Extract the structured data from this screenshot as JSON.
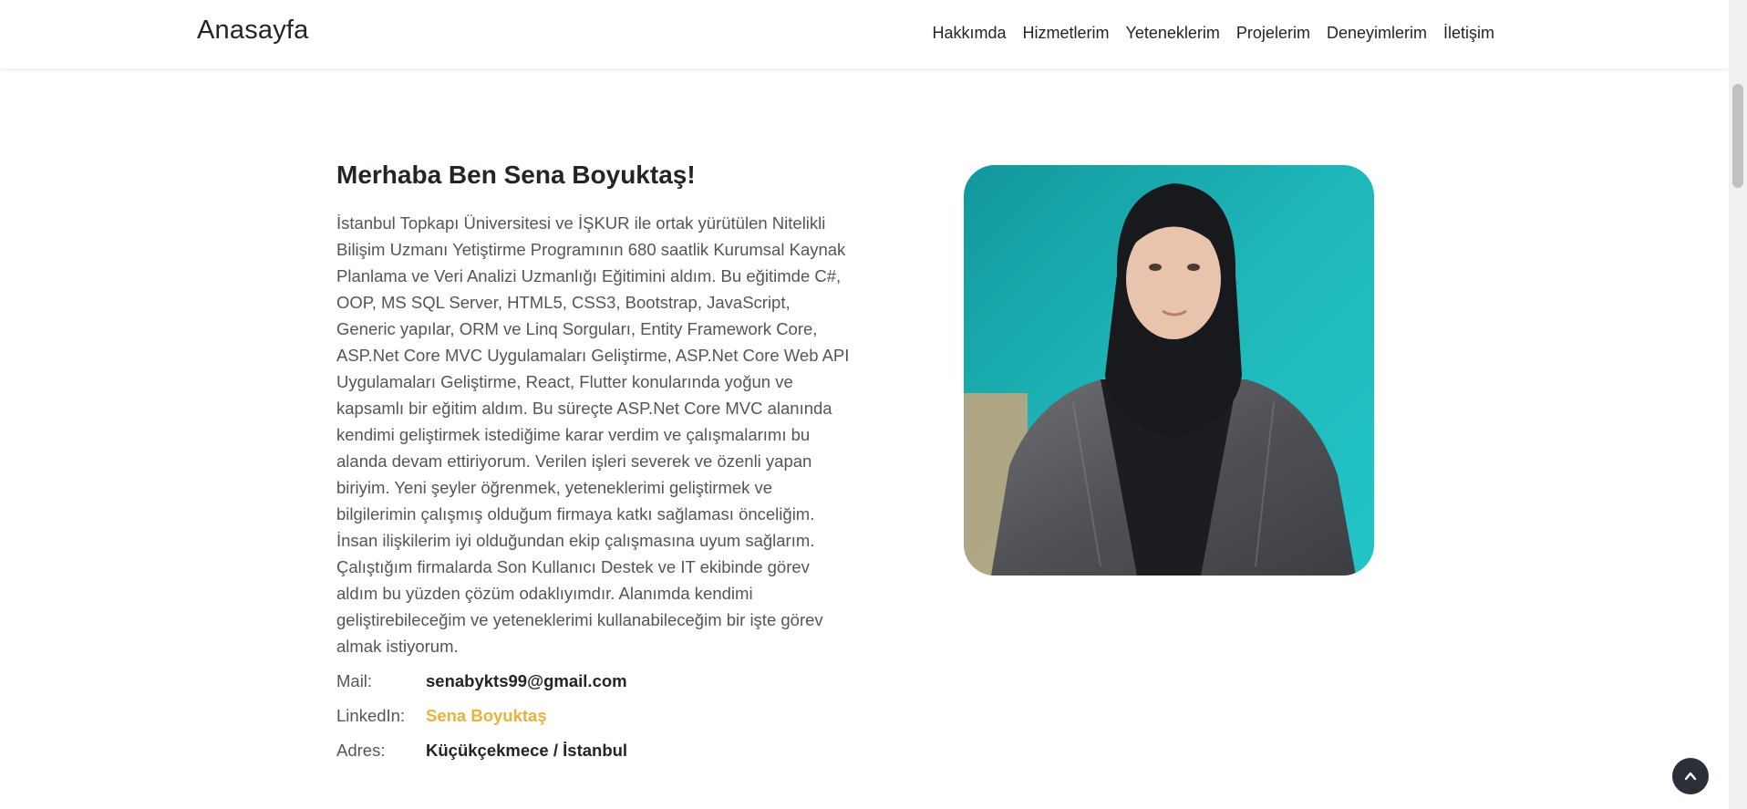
{
  "nav": {
    "brand": "Anasayfa",
    "links": [
      "Hakkımda",
      "Hizmetlerim",
      "Yeteneklerim",
      "Projelerim",
      "Deneyimlerim",
      "İletişim"
    ]
  },
  "about": {
    "title": "Merhaba Ben Sena Boyuktaş!",
    "text": "İstanbul Topkapı Üniversitesi ve İŞKUR ile ortak yürütülen Nitelikli Bilişim Uzmanı Yetiştirme Programının 680 saatlik Kurumsal Kaynak Planlama ve Veri Analizi Uzmanlığı Eğitimini aldım. Bu eğitimde C#, OOP, MS SQL Server, HTML5, CSS3, Bootstrap, JavaScript, Generic yapılar, ORM ve Linq Sorguları, Entity Framework Core, ASP.Net Core MVC Uygulamaları Geliştirme, ASP.Net Core Web API Uygulamaları Geliştirme, React, Flutter konularında yoğun ve kapsamlı bir eğitim aldım. Bu süreçte ASP.Net Core MVC alanında kendimi geliştirmek istediğime karar verdim ve çalışmalarımı bu alanda devam ettiriyorum. Verilen işleri severek ve özenli yapan biriyim. Yeni şeyler öğrenmek, yeteneklerimi geliştirmek ve bilgilerimin çalışmış olduğum firmaya katkı sağlaması önceliğim. İnsan ilişkilerim iyi olduğundan ekip çalışmasına uyum sağlarım. Çalıştığım firmalarda Son Kullanıcı Destek ve IT ekibinde görev aldım bu yüzden çözüm odaklıyımdır. Alanımda kendimi geliştirebileceğim ve yeteneklerimi kullanabileceğim bir işte görev almak istiyorum.",
    "info": {
      "mail_label": "Mail:",
      "mail_value": "senabykts99@gmail.com",
      "linkedin_label": "LinkedIn:",
      "linkedin_value": "Sena Boyuktaş",
      "address_label": "Adres:",
      "address_value": "Küçükçekmece / İstanbul"
    }
  },
  "icons": {
    "back_to_top": "chevron-up-icon",
    "photo": "profile-photo"
  },
  "colors": {
    "accent": "#e9b23c",
    "photo_bg": "#1fb5b8",
    "back_to_top_bg": "#2b3038"
  }
}
